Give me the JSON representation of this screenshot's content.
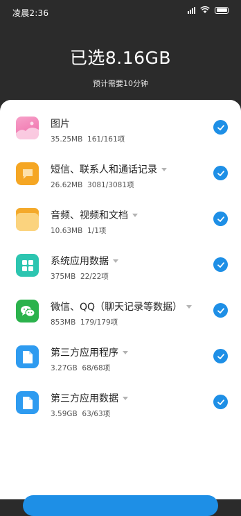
{
  "status_bar": {
    "time": "凌晨2:36"
  },
  "header": {
    "title": "已选8.16GB",
    "subtitle": "预计需要10分钟"
  },
  "items": [
    {
      "label": "图片",
      "size": "35.25MB",
      "count": "161/161项",
      "has_dropdown": false,
      "checked": true,
      "icon": "pictures-icon"
    },
    {
      "label": "短信、联系人和通话记录",
      "size": "26.62MB",
      "count": "3081/3081项",
      "has_dropdown": true,
      "checked": true,
      "icon": "messages-icon"
    },
    {
      "label": "音频、视频和文档",
      "size": "10.63MB",
      "count": "1/1项",
      "has_dropdown": true,
      "checked": true,
      "icon": "folder-icon"
    },
    {
      "label": "系统应用数据",
      "size": "375MB",
      "count": "22/22项",
      "has_dropdown": true,
      "checked": true,
      "icon": "system-apps-icon"
    },
    {
      "label": "微信、QQ（聊天记录等数据）",
      "size": "853MB",
      "count": "179/179项",
      "has_dropdown": true,
      "checked": true,
      "icon": "wechat-icon"
    },
    {
      "label": "第三方应用程序",
      "size": "3.27GB",
      "count": "68/68项",
      "has_dropdown": true,
      "checked": true,
      "icon": "app-file-icon"
    },
    {
      "label": "第三方应用数据",
      "size": "3.59GB",
      "count": "63/63项",
      "has_dropdown": true,
      "checked": true,
      "icon": "app-data-icon"
    }
  ],
  "colors": {
    "header_bg": "#2b2b2b",
    "accent": "#1e8fe6",
    "pictures": "#f07bb0",
    "messages": "#f5a623",
    "folder": "#f6b73c",
    "system": "#2cc5b0",
    "wechat": "#2bb24c",
    "app": "#2e9bf0"
  }
}
